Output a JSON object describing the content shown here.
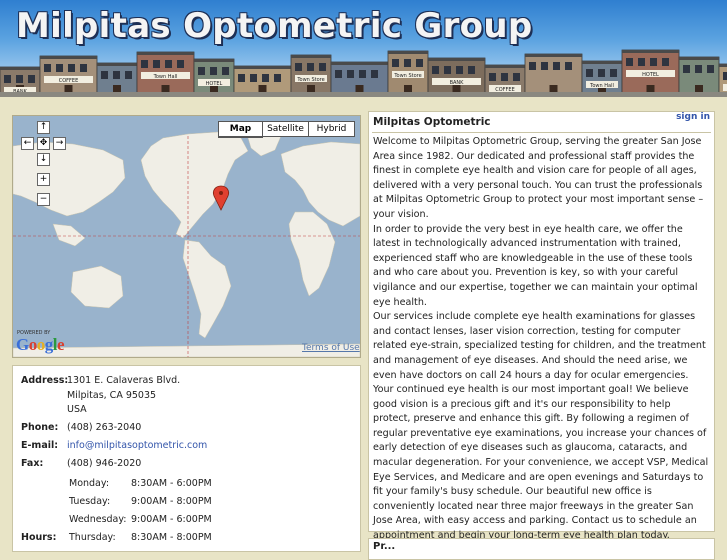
{
  "header": {
    "site_title": "Milpitas Optometric Group",
    "storefront_signs": [
      "BANK",
      "COFFEE",
      "",
      "Town Hall",
      "HOTEL",
      "",
      "Town Store",
      "",
      "Town Store"
    ]
  },
  "map": {
    "buttons": {
      "map": "Map",
      "satellite": "Satellite",
      "hybrid": "Hybrid"
    },
    "controls": {
      "up": "↑",
      "left": "←",
      "center": "✥",
      "right": "→",
      "down": "↓",
      "zoom_in": "+",
      "zoom_out": "−"
    },
    "powered_by": "POWERED BY",
    "logo": [
      "G",
      "o",
      "o",
      "g",
      "l",
      "e"
    ],
    "logo_colors": [
      "#3a6fd8",
      "#d84030",
      "#e8b020",
      "#3a6fd8",
      "#2a9a40",
      "#d84030"
    ],
    "terms": "Terms of Use",
    "ocean_color": "#99b3cc",
    "land_color": "#f0eee6"
  },
  "contact": {
    "address_label": "Address:",
    "address_lines": [
      "1301 E. Calaveras Blvd.",
      "Milpitas, CA 95035",
      "USA"
    ],
    "phone_label": "Phone:",
    "phone": "(408) 263-2040",
    "email_label": "E-mail:",
    "email": "info@milpitasoptometric.com",
    "fax_label": "Fax:",
    "fax": "(408) 946-2020",
    "hours_label": "Hours:",
    "hours": [
      {
        "day": "Monday:",
        "time": "8:30AM - 6:00PM"
      },
      {
        "day": "Tuesday:",
        "time": "9:00AM - 8:00PM"
      },
      {
        "day": "Wednesday:",
        "time": "9:00AM - 6:00PM"
      },
      {
        "day": "Thursday:",
        "time": "8:30AM - 8:00PM"
      }
    ]
  },
  "content": {
    "title": "Milpitas Optometric",
    "sign_in": "sign in",
    "paragraphs": [
      "Welcome to Milpitas Optometric Group, serving the greater San Jose Area since 1982. Our dedicated and professional staff provides the finest in complete eye health and vision care for people of all ages, delivered with a very personal touch. You can trust the professionals at Milpitas Optometric Group to protect your most important sense – your vision.",
      "In order to provide the very best in eye health care, we offer the latest in technologically advanced instrumentation with trained, experienced staff who are knowledgeable in the use of these tools and who care about you. Prevention is key, so with your careful vigilance and our expertise, together we can maintain your optimal eye health.",
      "Our services include complete eye health examinations for glasses and contact lenses, laser vision correction, testing for computer related eye-strain, specialized testing for children, and the treatment and management of eye diseases. And should the need arise, we even have doctors on call 24 hours a day for ocular emergencies. Your continued eye health is our most important goal! We believe good vision is a precious gift and it's our responsibility to help protect, preserve and enhance this gift. By following a regimen of regular preventative eye examinations, you increase your chances of early detection of eye diseases such as glaucoma, cataracts, and macular degeneration. For your convenience, we accept VSP, Medical Eye Services, and Medicare and are open evenings and Saturdays to fit your family's busy schedule. Our beautiful new office is conveniently located near three major freeways in the greater San Jose Area, with easy access and parking. Contact us to schedule an appointment and begin your long-term eye health plan today."
    ]
  },
  "bottom_panel": {
    "title": "Pr..."
  }
}
